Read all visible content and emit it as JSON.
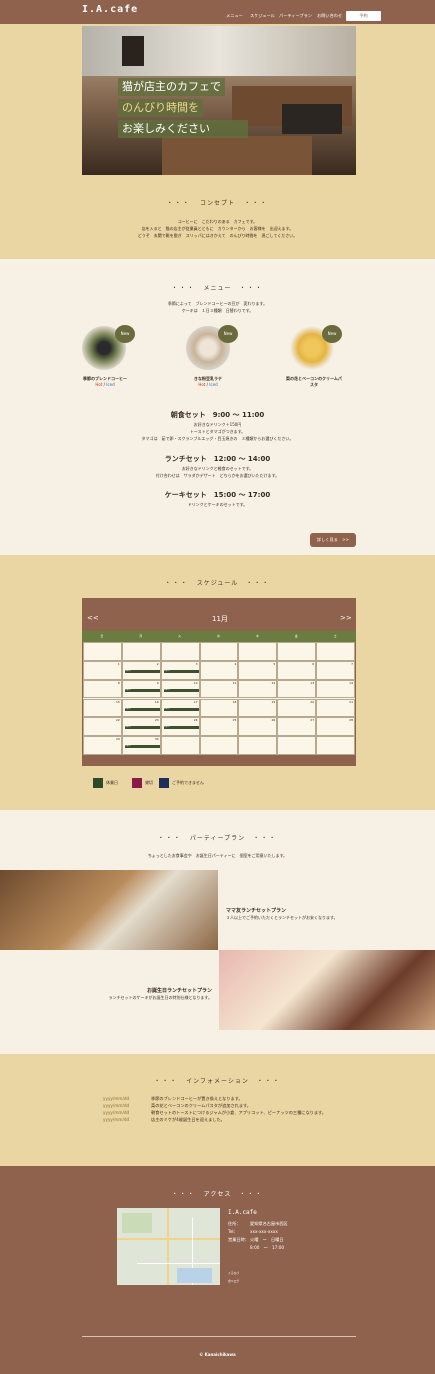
{
  "header": {
    "logo": "I.A.cafe",
    "nav": [
      "メニュー",
      "スケジュール",
      "パーティープラン",
      "お問い合わせ"
    ],
    "reserve": "予約"
  },
  "hero": {
    "line1": "猫が店主のカフェで",
    "line2": "のんびり時間を",
    "line3": "お楽しみください"
  },
  "concept": {
    "title": "コンセプト",
    "dots": "・・・",
    "lines": [
      "コーヒーに　こだわりのある　カフェです。",
      "店を入ると　猫の店主が従業員とともに　カウンターから　お客様を　出迎えます。",
      "どうぞ　玄関で靴を脱ぎ　スリッパにはきかえて　のんびり時間を　過ごしてください。"
    ]
  },
  "menu": {
    "title": "メニュー",
    "intro": [
      "季節によって　ブレンドコーヒーの豆が　変わります。",
      "ケーキは　１日３種類　日替わりです。"
    ],
    "items": [
      {
        "name": "季節のブレンドコーヒー",
        "badge": "New",
        "hot": "Hot",
        "sep": "/",
        "iced": "Iced"
      },
      {
        "name": "きな粉豆乳ラテ",
        "badge": "New",
        "hot": "Hot",
        "sep": "/",
        "iced": "Iced"
      },
      {
        "name": "菜の花とベーコンのクリームパスタ",
        "badge": "New"
      }
    ],
    "sets": [
      {
        "title": "朝食セット　9:00 ～ 11:00",
        "lines": [
          "お好きなドリンク＋150円",
          "トーストとタマゴがつきます。",
          "タマゴは　茹で卵・スクランブルエッグ・目玉焼きの　３種類からお選びください。"
        ]
      },
      {
        "title": "ランチセット　12:00 ～ 14:00",
        "lines": [
          "お好きなドリンクと軽食のセットです。",
          "付け合わせは　サラダかデザート　どちらかをお選びいただけます。"
        ]
      },
      {
        "title": "ケーキセット　15:00 ～ 17:00",
        "lines": [
          "ドリンクとケーキのセットです。"
        ]
      }
    ],
    "more": "詳しく見る　>>"
  },
  "schedule": {
    "title": "スケジュール",
    "prev": "<<",
    "next": ">>",
    "month": "11月",
    "dow": [
      "日",
      "月",
      "火",
      "水",
      "木",
      "金",
      "土"
    ],
    "weeks": [
      [
        "",
        "",
        "",
        "",
        "",
        "",
        ""
      ],
      [
        "1",
        "2",
        "3",
        "4",
        "5",
        "6",
        "7"
      ],
      [
        "8",
        "9",
        "10",
        "11",
        "12",
        "13",
        "14"
      ],
      [
        "15",
        "16",
        "17",
        "18",
        "19",
        "20",
        "21"
      ],
      [
        "22",
        "23",
        "24",
        "25",
        "26",
        "27",
        "28"
      ],
      [
        "29",
        "30",
        "",
        "",
        "",
        "",
        ""
      ]
    ],
    "legend": [
      {
        "label": "休業日",
        "color": "#2f4a2a"
      },
      {
        "label": "貸切",
        "color": "#8b1a4a"
      },
      {
        "label": "ご予約できません",
        "color": "#1f2e5a"
      }
    ],
    "event_label": "休業日"
  },
  "party": {
    "title": "パーティープラン",
    "intro": "ちょっとしたお食事会や　お誕生日パーティーに　個室をご用意いたします。",
    "plans": [
      {
        "title": "ママ友ランチセットプラン",
        "desc": "３人以上でご予約いただくとランチセットがお安くなります。"
      },
      {
        "title": "お誕生日ランチセットプラン",
        "desc": "ランチセットのケーキがお誕生日の特別仕様となります。"
      }
    ]
  },
  "info": {
    "title": "インフォメーション",
    "rows": [
      {
        "date": "yyyy/mm/dd",
        "text": "季節のブレンドコーヒーが置き換えとなります。"
      },
      {
        "date": "yyyy/mm/dd",
        "text": "菜の花とベーコンのクリームパスタが追加されます。"
      },
      {
        "date": "yyyy/mm/dd",
        "text": "朝食セットのトーストにつけるジャムが小倉、アプリコット、ピーナッツの三種になります。"
      },
      {
        "date": "yyyy/mm/dd",
        "text": "店主のミケが4歳誕生日を迎えました。"
      }
    ]
  },
  "access": {
    "title": "アクセス",
    "name": "I.A.cafe",
    "addr_label": "住所：",
    "addr": "愛知県名古屋市西区",
    "tel_label": "Tel：",
    "tel": "xxx-xxx-xxxx",
    "hours_label": "営業日時：",
    "days": "火曜　～　日曜日",
    "hours": "8:00　～　17:00",
    "note1": "ぐるなび",
    "note2": "食べログ"
  },
  "footer": {
    "copy": "© Kanaichikawa"
  }
}
